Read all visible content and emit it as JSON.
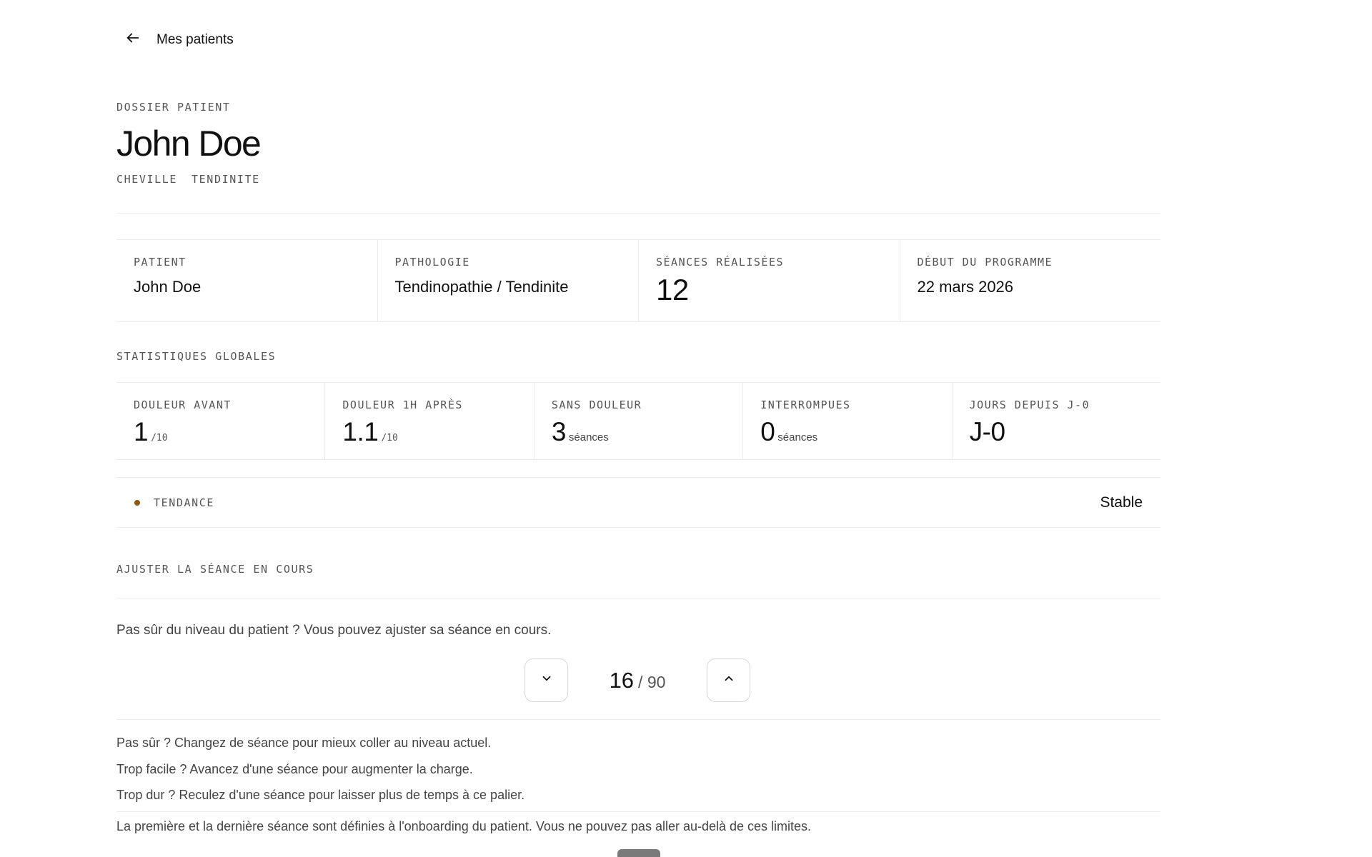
{
  "nav": {
    "back_label": "Mes patients"
  },
  "header": {
    "eyebrow": "DOSSIER PATIENT",
    "title": "John Doe",
    "tags": [
      "CHEVILLE",
      "TENDINITE"
    ]
  },
  "info": {
    "patient_label": "PATIENT",
    "patient_value": "John Doe",
    "pathology_label": "PATHOLOGIE",
    "pathology_value": "Tendinopathie / Tendinite",
    "sessions_label": "SÉANCES RÉALISÉES",
    "sessions_value": "12",
    "start_label": "DÉBUT DU PROGRAMME",
    "start_value": "22 mars 2026"
  },
  "stats": {
    "section_label": "STATISTIQUES GLOBALES",
    "items": [
      {
        "label": "DOULEUR AVANT",
        "value": "1",
        "unit": "/10"
      },
      {
        "label": "DOULEUR 1H APRÈS",
        "value": "1.1",
        "unit": "/10"
      },
      {
        "label": "SANS DOULEUR",
        "value": "3",
        "unit": "séances"
      },
      {
        "label": "INTERROMPUES",
        "value": "0",
        "unit": "séances"
      },
      {
        "label": "JOURS DEPUIS J-0",
        "value": "J-0",
        "unit": ""
      }
    ]
  },
  "trend": {
    "label": "TENDANCE",
    "value": "Stable",
    "dot_color": "#8a5a14"
  },
  "adjust": {
    "section_label": "AJUSTER LA SÉANCE EN COURS",
    "intro": "Pas sûr du niveau du patient ? Vous pouvez ajuster sa séance en cours.",
    "current": "16",
    "total": "/ 90",
    "help_lines": [
      "Pas sûr ? Changez de séance pour mieux coller au niveau actuel.",
      "Trop facile ? Avancez d'une séance pour augmenter la charge.",
      "Trop dur ? Reculez d'une séance pour laisser plus de temps à ce palier."
    ],
    "limits_note": "La première et la dernière séance sont définies à l'onboarding du patient. Vous ne pouvez pas aller au-delà de ces limites."
  },
  "icons": {
    "back": "arrow-left-icon",
    "decrement": "chevron-down-icon",
    "increment": "chevron-up-icon"
  }
}
